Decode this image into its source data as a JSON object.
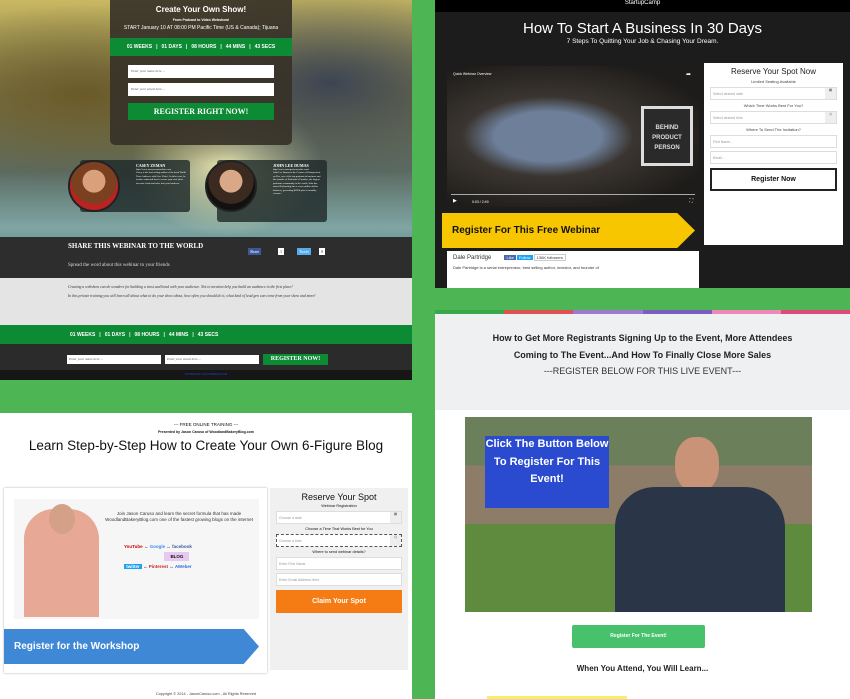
{
  "panel1": {
    "title": "Create Your Own Show!",
    "subtitle": "From Podcast to Video Webshow!",
    "start": "START January 10 AT 08:00 PM Pacific Time (US & Canada); Tijuana",
    "countdown": [
      "01 WEEKS",
      "01 DAYS",
      "08 HOURS",
      "44 MINS",
      "43 SECS"
    ],
    "name_placeholder": "Enter your name here ...",
    "email_placeholder": "Enter your email here ...",
    "register_label": "REGISTER RIGHT NOW!",
    "speakers": [
      {
        "name": "CASEY ZEMAN",
        "url": "http://www.caseyzemanonline.com",
        "bio": "Casey is the best selling author of the book 'Build Your Audience with Live Video'. In this event, he teaches what and how to create your own show for more leads and sales into your business."
      },
      {
        "name": "JOHN LEE DUMAS",
        "url": "http://www.entrepreneuronfire.com/",
        "bio": "John Lee Dumas is the Creator of Entrepreneur on Fire, one of the top podcasts in business and the founder of Podcaster's Paradise, the largest podcaster community in the world. John has turned Podcasting into a seven million dollar business, generating $200k plus in monthly revenue."
      }
    ],
    "share_title": "SHARE THIS WEBINAR TO THE WORLD",
    "share_sub": "Spread the word about this webinar to your friends",
    "fb_share": "Share",
    "fb_count": "1",
    "tweet": "Tweet",
    "tweet_count": "0",
    "desc1": "Creating a webshow can do wonders for building a trust and bond with your audience.  Not to mention help you build an audience in the first place!",
    "desc2": "In this private training you will learn all about what to do your show about, how often you should do it, what kind of lead gen can come from your show and more!",
    "register_now": "REGISTER NOW!",
    "footer": "POWERED BY EASYWEBINAR.COM"
  },
  "panel2": {
    "logo": "StartupCamp",
    "title": "How To Start A Business In 30 Days",
    "tagline": "7 Steps To Quitting Your Job & Chasing Your Dream.",
    "video_title": "Quick Webinar Overview",
    "video_time": "0:03 / 2:49",
    "sign": "BEHIND PRODUCT PERSON",
    "banner": "Register For This Free Webinar",
    "form_title": "Reserve Your Spot Now",
    "form_sub": "Limited Seating Available",
    "date_placeholder": "Select desired date",
    "time_q": "Which Time Works Best For You?",
    "time_placeholder": "Select desired time",
    "send_q": "Where To Send The Invitation?",
    "first_placeholder": "First Name...",
    "email_placeholder": "Email...",
    "register": "Register Now",
    "host": "Dale Partridge",
    "like": "Like",
    "follow": "Follow",
    "followers": "136K followers",
    "bio": "Dale Partridge is a serial entrepreneur, best selling author, investor, and founder of"
  },
  "panel3": {
    "kicker": "--- FREE ONLINE TRAINING ---",
    "presenter": "Presented by Jason Caruso of WoodlandBakeryBlog.com",
    "title": "Learn Step-by-Step How to Create Your Own 6-Figure Blog",
    "intro": "Join Jason Caruso and learn the secret formula that has made WoodlandBakeryBlog.com one of the fastest growing blogs on the internet",
    "diagram": [
      "YouTube",
      "Google",
      "facebook",
      "BLOG",
      "twitter",
      "Pinterest",
      "AWeber"
    ],
    "banner": "Register for the Workshop",
    "form_title": "Reserve Your Spot",
    "form_sub": "Webinar Registration",
    "date_placeholder": "Choose a date",
    "time_q": "Choose a Time That Works Best for You",
    "time_placeholder": "Choose a time",
    "send_q": "Where to send webinar details?",
    "first_placeholder": "Enter First Name",
    "email_placeholder": "Enter Email Address Here",
    "claim": "Claim Your Spot",
    "copyright": "Copyright © 2014 - JasonCaruso.com - All Rights Reserved"
  },
  "panel4": {
    "stripe_colors": [
      "#3aa84a",
      "#e05050",
      "#9b7ad0",
      "#7a5fc0",
      "#ee88b8",
      "#e04878"
    ],
    "headline": "How to Get More Registrants Signing Up to the Event, More Attendees Coming to The Event...And How To Finally Close More Sales",
    "register_below": "---REGISTER BELOW FOR THIS LIVE EVENT---",
    "overlay": "Click The Button Below To Register For This Event!",
    "button": "Register For The Event!",
    "learn": "When You Attend, You Will Learn..."
  },
  "colors": {
    "background": "#4db554",
    "countdown_green": "#0c8a34",
    "yellow": "#f7c600",
    "blue": "#3e88d6",
    "orange": "#f57c14",
    "event_green": "#47c16b"
  }
}
